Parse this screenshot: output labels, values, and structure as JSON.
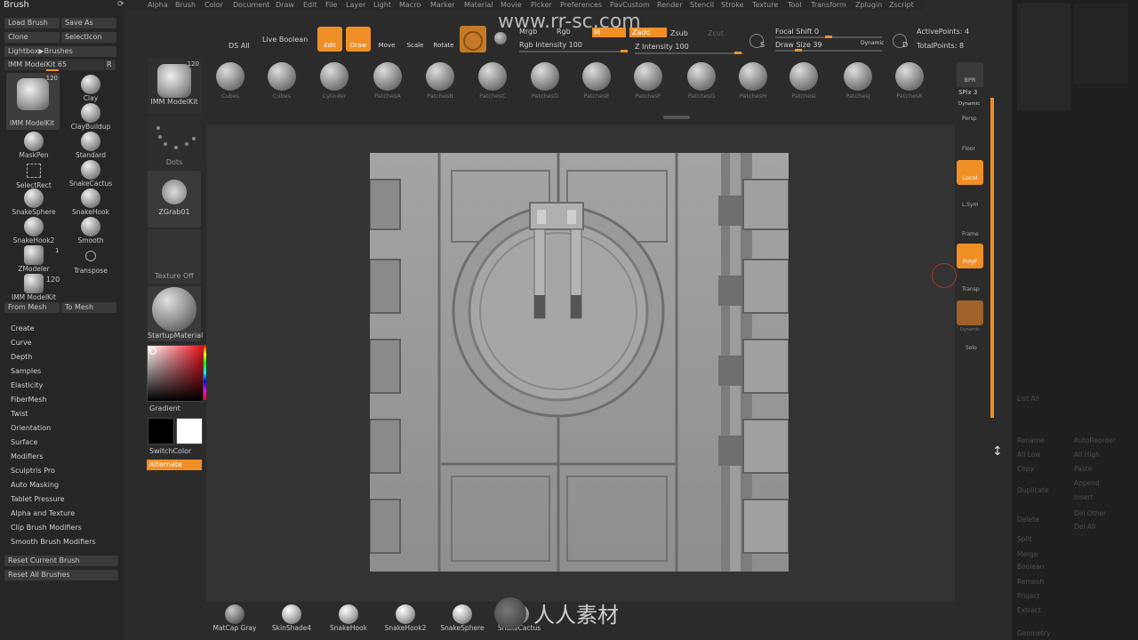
{
  "menu": [
    "Alpha",
    "Brush",
    "Color",
    "Document",
    "Draw",
    "Edit",
    "File",
    "Layer",
    "Light",
    "Macro",
    "Marker",
    "Material",
    "Movie",
    "Picker",
    "Preferences",
    "PavCustom",
    "Render",
    "Stencil",
    "Stroke",
    "Texture",
    "Tool",
    "Transform",
    "Zplugin",
    "Zscript"
  ],
  "left": {
    "title": "Brush",
    "load_brush": "Load Brush",
    "save_as": "Save As",
    "clone": "Clone",
    "select_icon": "SelectIcon",
    "lightbox_brushes": "Lightbox▶Brushes",
    "imm_label": "IMM ModelKit",
    "imm_value": "65",
    "imm_r": "R",
    "current_brush_badge": "120",
    "current_brush_name": "IMM ModelKit",
    "brushes": [
      {
        "name": "Clay"
      },
      {
        "name": "ClayBuildup"
      },
      {
        "name": "MaskPen"
      },
      {
        "name": "Standard"
      },
      {
        "name": "SelectRect"
      },
      {
        "name": "SnakeCactus"
      },
      {
        "name": "SnakeSphere"
      },
      {
        "name": "SnakeHook"
      },
      {
        "name": "SnakeHook2"
      },
      {
        "name": "Smooth"
      },
      {
        "name": "ZModeler"
      },
      {
        "name": "Transpose"
      }
    ],
    "zmodeler_count": "1",
    "imm2_name": "IMM ModelKit",
    "imm2_badge": "120",
    "from_mesh": "From Mesh",
    "to_mesh": "To Mesh",
    "sections": [
      "Create",
      "Curve",
      "Depth",
      "Samples",
      "Elasticity",
      "FiberMesh",
      "Twist",
      "Orientation",
      "Surface",
      "Modifiers",
      "Sculptris Pro",
      "Auto Masking",
      "Tablet Pressure",
      "Alpha and Texture",
      "Clip Brush Modifiers",
      "Smooth Brush Modifiers"
    ],
    "reset_current": "Reset Current Brush",
    "reset_all": "Reset All Brushes"
  },
  "col2": {
    "brush_name": "IMM ModelKit",
    "brush_badge": "120",
    "stroke": "Dots",
    "alpha": "ZGrab01",
    "texture": "Texture Off",
    "material": "StartupMaterial",
    "gradient": "Gradient",
    "switch_color": "SwitchColor",
    "alternate": "Alternate"
  },
  "toolbar": {
    "ds_all": "DS All",
    "live_boolean": "Live Boolean",
    "edit": "Edit",
    "draw": "Draw",
    "move": "Move",
    "scale": "Scale",
    "rotate": "Rotate",
    "mrgb": "Mrgb",
    "rgb": "Rgb",
    "m": "M",
    "zadd": "Zadd",
    "zsub": "Zsub",
    "zcut": "Zcut",
    "rgb_intensity": "Rgb Intensity 100",
    "z_intensity": "Z Intensity 100",
    "focal_shift": "Focal Shift 0",
    "draw_size": "Draw Size 39",
    "dynamic": "Dynamic",
    "active_points": "ActivePoints: 4",
    "total_points": "TotalPoints: 8",
    "s_label": "S",
    "d_label": "D"
  },
  "shelf": [
    "Cubes",
    "Cubes",
    "Cylinder",
    "PatchesA",
    "PatchesB",
    "PatchesC",
    "PatchesD",
    "PatchesE",
    "PatchesF",
    "PatchesG",
    "PatchesH",
    "PatchesI",
    "PatchesJ",
    "PatchesK"
  ],
  "right_shelf": {
    "bpr": "BPR",
    "spix": "SPix 3",
    "dynamic": "Dynamic",
    "persp": "Persp",
    "floor": "Floor",
    "local": "Local",
    "lsym": "L.Sym",
    "frame": "Frame",
    "polyf": "PolyF",
    "transp": "Transp",
    "dynamic2": "Dynamic",
    "solo": "Solo"
  },
  "right_tray": [
    "List All",
    "Rename",
    "AutoReorder",
    "All Low",
    "All High",
    "Copy",
    "Paste",
    "Append",
    "Insert",
    "Duplicate",
    "Delete",
    "Del Other",
    "Del All",
    "Split",
    "Merge",
    "Boolean",
    "Remesh",
    "Project",
    "Extract",
    "Geometry"
  ],
  "bottom": [
    "MatCap Gray",
    "SkinShade4",
    "SnakeHook",
    "SnakeHook2",
    "SnakeSphere",
    "SnakeCactus"
  ],
  "watermarks": {
    "url": "www.rr-sc.com",
    "logo_text": "人人素材"
  },
  "colors": {
    "accent": "#f08f26",
    "bg": "#2b2b2b",
    "panel": "#262626"
  }
}
